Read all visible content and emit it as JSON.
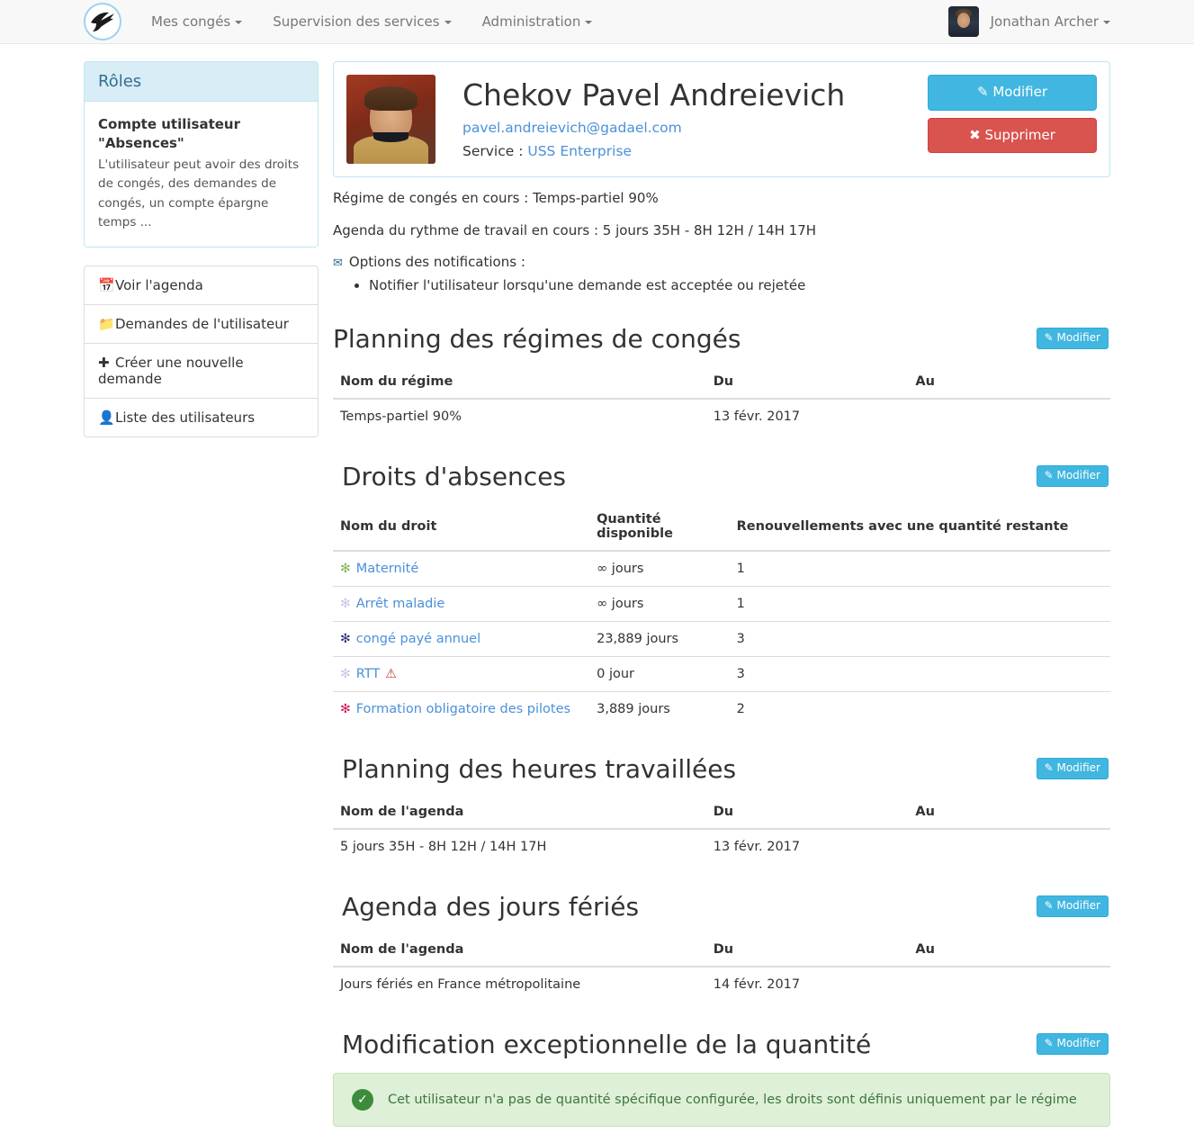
{
  "navbar": {
    "brand_icon": "swallow-bird-logo",
    "items": [
      {
        "label": "Mes congés",
        "icon": "chevron-down-icon"
      },
      {
        "label": "Supervision des services",
        "icon": "chevron-down-icon"
      },
      {
        "label": "Administration",
        "icon": "chevron-down-icon"
      }
    ],
    "user": {
      "name": "Jonathan Archer",
      "avatar": "user-avatar"
    }
  },
  "sidebar": {
    "roles_panel": {
      "title": "Rôles",
      "role_name": "Compte utilisateur \"Absences\"",
      "role_description": "L'utilisateur peut avoir des droits de congés, des demandes de congés, un compte épargne temps ..."
    },
    "menu": [
      {
        "label": "Voir l'agenda",
        "icon": "calendar-icon",
        "glyph": "▦"
      },
      {
        "label": "Demandes de l'utilisateur",
        "icon": "folder-icon",
        "glyph": "▰"
      },
      {
        "label": "Créer une nouvelle demande",
        "icon": "plus-icon",
        "glyph": "✚"
      },
      {
        "label": "Liste des utilisateurs",
        "icon": "user-icon",
        "glyph": "👤"
      }
    ]
  },
  "user_card": {
    "photo": "chekov-portrait",
    "name": "Chekov Pavel Andreievich",
    "email": "pavel.andreievich@gadael.com",
    "service_label": "Service :",
    "service_value": "USS Enterprise",
    "edit_button": "Modifier",
    "delete_button": "Supprimer",
    "edit_icon": "pencil-square-icon",
    "delete_icon": "times-icon"
  },
  "info": {
    "regime_line": "Régime de congés en cours : Temps-partiel 90%",
    "agenda_line": "Agenda du rythme de travail en cours : 5 jours 35H - 8H 12H / 14H 17H",
    "notifications_title": "Options des notifications :",
    "notifications_icon": "envelope-icon",
    "notifications": [
      "Notifier l'utilisateur lorsqu'une demande est acceptée ou rejetée"
    ]
  },
  "sections": {
    "regimes": {
      "title": "Planning des régimes de congés",
      "edit_button": "Modifier",
      "columns": [
        "Nom du régime",
        "Du",
        "Au"
      ],
      "rows": [
        {
          "name": "Temps-partiel 90%",
          "du": "13 févr. 2017",
          "au": ""
        }
      ]
    },
    "droits": {
      "title": "Droits d'absences",
      "edit_button": "Modifier",
      "columns": [
        "Nom du droit",
        "Quantité disponible",
        "Renouvellements avec une quantité restante"
      ],
      "rows": [
        {
          "name": "Maternité",
          "quantity": "∞ jours",
          "renewals": "1",
          "color": "#7cb84f",
          "warning": false
        },
        {
          "name": "Arrêt maladie",
          "quantity": "∞ jours",
          "renewals": "1",
          "color": "#c6c8e8",
          "warning": false
        },
        {
          "name": "congé payé annuel",
          "quantity": "23,889 jours",
          "renewals": "3",
          "color": "#2b2f7a",
          "warning": false
        },
        {
          "name": "RTT",
          "quantity": "0 jour",
          "renewals": "3",
          "color": "#c6c8e8",
          "warning": true
        },
        {
          "name": "Formation obligatoire des pilotes",
          "quantity": "3,889 jours",
          "renewals": "2",
          "color": "#d6185a",
          "warning": false
        }
      ]
    },
    "heures": {
      "title": "Planning des heures travaillées",
      "edit_button": "Modifier",
      "columns": [
        "Nom de l'agenda",
        "Du",
        "Au"
      ],
      "rows": [
        {
          "name": "5 jours 35H - 8H 12H / 14H 17H",
          "du": "13 févr. 2017",
          "au": ""
        }
      ]
    },
    "feries": {
      "title": "Agenda des jours fériés",
      "edit_button": "Modifier",
      "columns": [
        "Nom de l'agenda",
        "Du",
        "Au"
      ],
      "rows": [
        {
          "name": "Jours fériés en France métropolitaine",
          "du": "14 févr. 2017",
          "au": ""
        }
      ]
    },
    "quantite": {
      "title": "Modification exceptionnelle de la quantité",
      "edit_button": "Modifier",
      "alert_icon": "check-circle-icon",
      "alert_text": "Cet utilisateur n'a pas de quantité spécifique configurée, les droits sont définis uniquement par le régime"
    }
  },
  "colors": {
    "accent": "#41b6e0",
    "danger": "#d9534f",
    "link": "#4a90d9",
    "panel_header": "#d9edf7",
    "panel_border": "#bce8f1",
    "alert_bg": "#dff0d8"
  }
}
